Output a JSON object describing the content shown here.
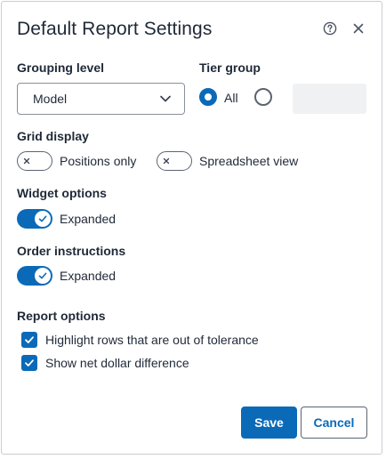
{
  "dialog": {
    "title": "Default Report Settings",
    "help_icon": "help-circle-icon",
    "close_icon": "close-icon"
  },
  "grouping": {
    "label": "Grouping level",
    "selected": "Model"
  },
  "tier": {
    "label": "Tier group",
    "options": [
      {
        "label": "All",
        "checked": true
      },
      {
        "label": "",
        "checked": false
      }
    ],
    "input_value": ""
  },
  "grid": {
    "label": "Grid display",
    "options": [
      {
        "label": "Positions only",
        "on": false
      },
      {
        "label": "Spreadsheet view",
        "on": false
      }
    ]
  },
  "widget": {
    "label": "Widget options",
    "toggle_label": "Expanded",
    "on": true
  },
  "order": {
    "label": "Order instructions",
    "toggle_label": "Expanded",
    "on": true
  },
  "report": {
    "label": "Report options",
    "options": [
      {
        "label": "Highlight rows that are out of tolerance",
        "checked": true
      },
      {
        "label": "Show net dollar difference",
        "checked": true
      }
    ]
  },
  "buttons": {
    "save": "Save",
    "cancel": "Cancel"
  },
  "colors": {
    "accent": "#0a6ab8",
    "text": "#1f2937",
    "border": "#5b6470"
  }
}
